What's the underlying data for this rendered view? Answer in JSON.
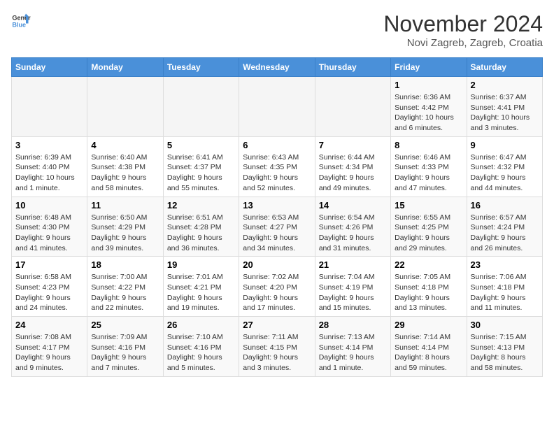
{
  "header": {
    "logo_general": "General",
    "logo_blue": "Blue",
    "title": "November 2024",
    "subtitle": "Novi Zagreb, Zagreb, Croatia"
  },
  "weekdays": [
    "Sunday",
    "Monday",
    "Tuesday",
    "Wednesday",
    "Thursday",
    "Friday",
    "Saturday"
  ],
  "weeks": [
    [
      {
        "day": "",
        "info": ""
      },
      {
        "day": "",
        "info": ""
      },
      {
        "day": "",
        "info": ""
      },
      {
        "day": "",
        "info": ""
      },
      {
        "day": "",
        "info": ""
      },
      {
        "day": "1",
        "info": "Sunrise: 6:36 AM\nSunset: 4:42 PM\nDaylight: 10 hours and 6 minutes."
      },
      {
        "day": "2",
        "info": "Sunrise: 6:37 AM\nSunset: 4:41 PM\nDaylight: 10 hours and 3 minutes."
      }
    ],
    [
      {
        "day": "3",
        "info": "Sunrise: 6:39 AM\nSunset: 4:40 PM\nDaylight: 10 hours and 1 minute."
      },
      {
        "day": "4",
        "info": "Sunrise: 6:40 AM\nSunset: 4:38 PM\nDaylight: 9 hours and 58 minutes."
      },
      {
        "day": "5",
        "info": "Sunrise: 6:41 AM\nSunset: 4:37 PM\nDaylight: 9 hours and 55 minutes."
      },
      {
        "day": "6",
        "info": "Sunrise: 6:43 AM\nSunset: 4:35 PM\nDaylight: 9 hours and 52 minutes."
      },
      {
        "day": "7",
        "info": "Sunrise: 6:44 AM\nSunset: 4:34 PM\nDaylight: 9 hours and 49 minutes."
      },
      {
        "day": "8",
        "info": "Sunrise: 6:46 AM\nSunset: 4:33 PM\nDaylight: 9 hours and 47 minutes."
      },
      {
        "day": "9",
        "info": "Sunrise: 6:47 AM\nSunset: 4:32 PM\nDaylight: 9 hours and 44 minutes."
      }
    ],
    [
      {
        "day": "10",
        "info": "Sunrise: 6:48 AM\nSunset: 4:30 PM\nDaylight: 9 hours and 41 minutes."
      },
      {
        "day": "11",
        "info": "Sunrise: 6:50 AM\nSunset: 4:29 PM\nDaylight: 9 hours and 39 minutes."
      },
      {
        "day": "12",
        "info": "Sunrise: 6:51 AM\nSunset: 4:28 PM\nDaylight: 9 hours and 36 minutes."
      },
      {
        "day": "13",
        "info": "Sunrise: 6:53 AM\nSunset: 4:27 PM\nDaylight: 9 hours and 34 minutes."
      },
      {
        "day": "14",
        "info": "Sunrise: 6:54 AM\nSunset: 4:26 PM\nDaylight: 9 hours and 31 minutes."
      },
      {
        "day": "15",
        "info": "Sunrise: 6:55 AM\nSunset: 4:25 PM\nDaylight: 9 hours and 29 minutes."
      },
      {
        "day": "16",
        "info": "Sunrise: 6:57 AM\nSunset: 4:24 PM\nDaylight: 9 hours and 26 minutes."
      }
    ],
    [
      {
        "day": "17",
        "info": "Sunrise: 6:58 AM\nSunset: 4:23 PM\nDaylight: 9 hours and 24 minutes."
      },
      {
        "day": "18",
        "info": "Sunrise: 7:00 AM\nSunset: 4:22 PM\nDaylight: 9 hours and 22 minutes."
      },
      {
        "day": "19",
        "info": "Sunrise: 7:01 AM\nSunset: 4:21 PM\nDaylight: 9 hours and 19 minutes."
      },
      {
        "day": "20",
        "info": "Sunrise: 7:02 AM\nSunset: 4:20 PM\nDaylight: 9 hours and 17 minutes."
      },
      {
        "day": "21",
        "info": "Sunrise: 7:04 AM\nSunset: 4:19 PM\nDaylight: 9 hours and 15 minutes."
      },
      {
        "day": "22",
        "info": "Sunrise: 7:05 AM\nSunset: 4:18 PM\nDaylight: 9 hours and 13 minutes."
      },
      {
        "day": "23",
        "info": "Sunrise: 7:06 AM\nSunset: 4:18 PM\nDaylight: 9 hours and 11 minutes."
      }
    ],
    [
      {
        "day": "24",
        "info": "Sunrise: 7:08 AM\nSunset: 4:17 PM\nDaylight: 9 hours and 9 minutes."
      },
      {
        "day": "25",
        "info": "Sunrise: 7:09 AM\nSunset: 4:16 PM\nDaylight: 9 hours and 7 minutes."
      },
      {
        "day": "26",
        "info": "Sunrise: 7:10 AM\nSunset: 4:16 PM\nDaylight: 9 hours and 5 minutes."
      },
      {
        "day": "27",
        "info": "Sunrise: 7:11 AM\nSunset: 4:15 PM\nDaylight: 9 hours and 3 minutes."
      },
      {
        "day": "28",
        "info": "Sunrise: 7:13 AM\nSunset: 4:14 PM\nDaylight: 9 hours and 1 minute."
      },
      {
        "day": "29",
        "info": "Sunrise: 7:14 AM\nSunset: 4:14 PM\nDaylight: 8 hours and 59 minutes."
      },
      {
        "day": "30",
        "info": "Sunrise: 7:15 AM\nSunset: 4:13 PM\nDaylight: 8 hours and 58 minutes."
      }
    ]
  ]
}
